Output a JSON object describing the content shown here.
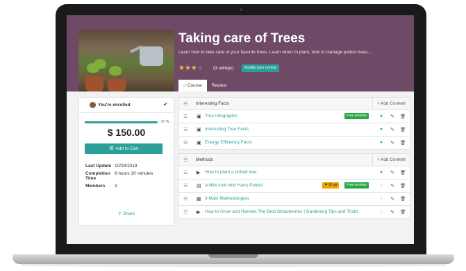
{
  "course": {
    "title": "Taking care of Trees",
    "description": "Learn how to take care of your favorite trees. Learn when to plant, how to manage potted trees, ...",
    "stars_filled": "★★★",
    "stars_empty": "★",
    "ratings": "(3 ratings)",
    "modify_review": "Modify your review"
  },
  "tabs": [
    {
      "icon": "home-icon",
      "label": "Course",
      "active": true
    },
    {
      "label": "Review",
      "active": false
    }
  ],
  "sidebar": {
    "enrolled_label": "You're enrolled",
    "progress_percent": 97,
    "progress_text": "97 %",
    "price": "$ 150.00",
    "add_to_cart": "Add to Cart",
    "info": [
      {
        "key": "Last Update",
        "value": "10/29/2019"
      },
      {
        "key": "Completion Time",
        "value": "8 hours 30 minutes"
      },
      {
        "key": "Members",
        "value": "3"
      }
    ],
    "share": "Share"
  },
  "sections": [
    {
      "title": "Interesting Facts",
      "add_content": "+ Add Content",
      "items": [
        {
          "icon": "infographic-icon",
          "title": "Tree Infographic",
          "badge": "Free preview",
          "status": "done"
        },
        {
          "icon": "infographic-icon",
          "title": "Interesting Tree Facts",
          "status": "done"
        },
        {
          "icon": "infographic-icon",
          "title": "Energy Efficiency Facts",
          "status": "done"
        }
      ]
    },
    {
      "title": "Methods",
      "add_content": "+ Add Content",
      "items": [
        {
          "icon": "video-icon",
          "title": "How to plant a potted tree",
          "status": "done"
        },
        {
          "icon": "document-icon",
          "title": "A little chat with Harry Potted",
          "xp_badge": "10 xp",
          "badge": "Free preview",
          "status": "todo"
        },
        {
          "icon": "presentation-icon",
          "title": "3 Main Methodologies",
          "status": "todo"
        },
        {
          "icon": "video-icon",
          "title": "How to Grow and Harvest The Best Strawberries | Gardening Tips and Tricks",
          "status": "todo"
        }
      ]
    }
  ],
  "colors": {
    "header": "#6e4a67",
    "accent": "#2aa198",
    "star": "#f3b73b",
    "done": "#28a745"
  }
}
